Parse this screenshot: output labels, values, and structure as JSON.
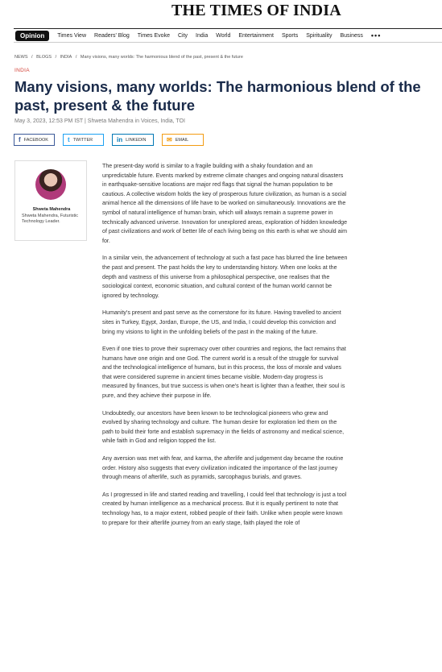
{
  "masthead": {
    "logo": "THE TIMES OF INDIA"
  },
  "nav": {
    "active": "Opinion",
    "items": [
      "Times View",
      "Readers' Blog",
      "Times Evoke",
      "City",
      "India",
      "World",
      "Entertainment",
      "Sports",
      "Spirituality",
      "Business"
    ],
    "more": "•••"
  },
  "breadcrumb": [
    "NEWS",
    "/",
    "BLOGS",
    "/",
    "INDIA",
    "/",
    "Many visions, many worlds: The harmonious blend of the past, present & the future"
  ],
  "article": {
    "section": "INDIA",
    "headline": "Many visions, many worlds: The harmonious blend of the past, present & the future",
    "meta": "May 3, 2023, 12:53 PM IST  |  Shweta Mahendra in Voices, India, TOI",
    "paragraphs": [
      "The present-day world is similar to a fragile building with a shaky foundation and an unpredictable future. Events marked by extreme climate changes and ongoing natural disasters in earthquake-sensitive locations are major red flags that signal the human population to be cautious. A collective wisdom holds the key of prosperous future civilization, as human is a social animal hence all the dimensions of life have to be worked on simultaneously. Innovations are the symbol of natural intelligence of human brain, which will always remain a supreme power in technically advanced universe. Innovation for unexplored areas, exploration of hidden knowledge of past civilizations and work of better life of each living being on this earth is what we should aim for.",
      "In a similar vein, the advancement of technology at such a fast pace has blurred the line between the past and present. The past holds the key to understanding history. When one looks at the depth and vastness of this universe from a philosophical perspective, one realises that the sociological context, economic situation, and cultural context of the human world cannot be ignored by technology.",
      "Humanity's present and past serve as the cornerstone for its future. Having travelled to ancient sites in Turkey, Egypt, Jordan, Europe, the US, and India, I could develop this conviction and bring my visions to light in the unfolding beliefs of the past in the making of the future.",
      "Even if one tries to prove their supremacy over other countries and regions, the fact remains that humans have one origin and one God. The current world is a result of the struggle for survival and the technological intelligence of humans, but in this process, the loss of morale and values that were considered supreme in ancient times became visible. Modern-day progress is measured by finances, but true success is when one's heart is lighter than a feather, their soul is pure, and they achieve their purpose in life.",
      "Undoubtedly, our ancestors have been known to be technological pioneers who grew and evolved by sharing technology and culture. The human desire for exploration led them on the path to build their forte and establish supremacy in the fields of astronomy and medical science, while faith in God and religion topped the list.",
      "Any aversion was met with fear, and karma, the afterlife and judgement day became the routine order. History also suggests that every civilization indicated the importance of the last journey through means of afterlife, such as pyramids, sarcophagus burials, and graves.",
      "As I progressed in life and started reading and travelling, I could feel that technology is just a tool created by human intelligence as a mechanical process. But it is equally pertinent to note that technology has, to a major extent, robbed people of their faith. Unlike when people were known to prepare for their afterlife journey from an early stage, faith played the role of"
    ]
  },
  "share": {
    "facebook": "FACEBOOK",
    "twitter": "TWITTER",
    "linkedin": "LINKEDIN",
    "email": "EMAIL"
  },
  "author": {
    "name": "Shweta Mahendra",
    "bio": "Shweta Mahendra, Futuristic Technology Leader."
  }
}
